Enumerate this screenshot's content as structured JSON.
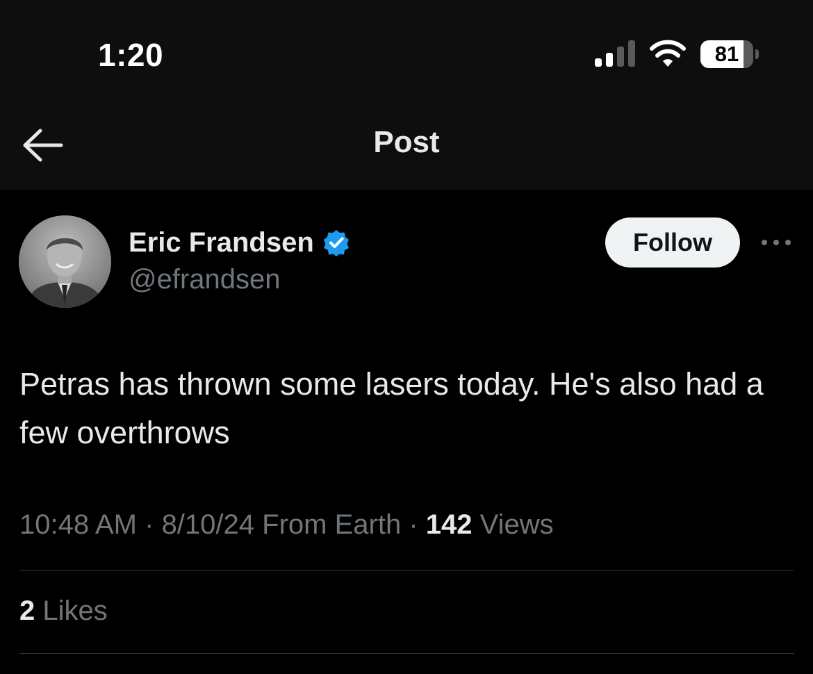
{
  "status_bar": {
    "time": "1:20",
    "battery_percent": "81",
    "battery_level": 0.81,
    "signal_bars_active": 2,
    "signal_bars_total": 4
  },
  "nav": {
    "title": "Post",
    "back_icon": "arrow-left-icon"
  },
  "author": {
    "name": "Eric Frandsen",
    "handle": "@efrandsen",
    "verified": true,
    "verified_color": "#1d9bf0"
  },
  "follow_label": "Follow",
  "more_icon": "more-horizontal-icon",
  "post": {
    "text": "Petras has thrown some lasers today. He's also had a few overthrows",
    "time": "10:48 AM",
    "date": "8/10/24",
    "source": "From Earth",
    "views_count": "142",
    "views_label": "Views",
    "likes_count": "2",
    "likes_label": "Likes"
  },
  "colors": {
    "background": "#000000",
    "header_background": "#0e0e0e",
    "text_primary": "#e7e9ea",
    "text_secondary": "#71767b",
    "divider": "#2f3336"
  }
}
